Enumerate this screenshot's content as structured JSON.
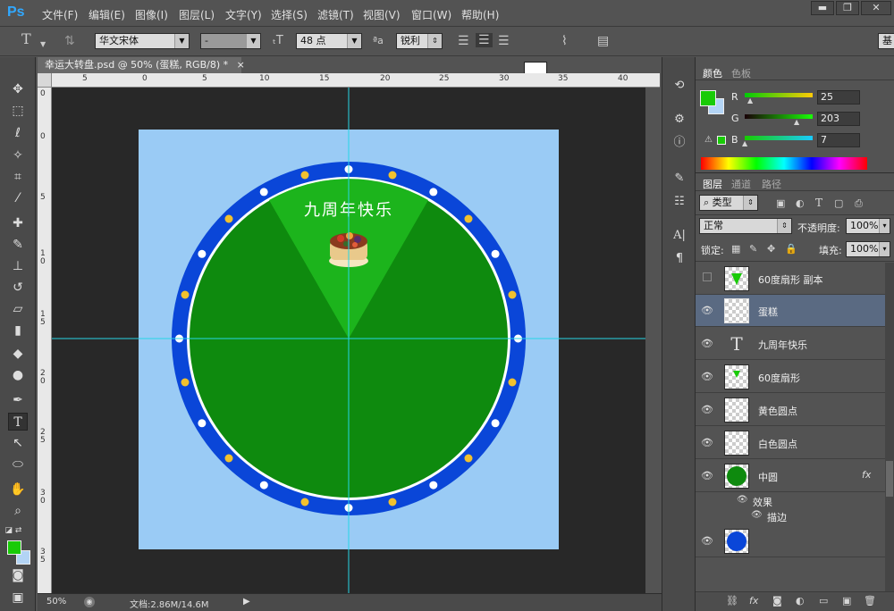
{
  "app": {
    "logo": "Ps"
  },
  "menu": [
    "文件(F)",
    "编辑(E)",
    "图像(I)",
    "图层(L)",
    "文字(Y)",
    "选择(S)",
    "滤镜(T)",
    "视图(V)",
    "窗口(W)",
    "帮助(H)"
  ],
  "window_controls": {
    "minimize": "▬",
    "restore": "❐",
    "close": "✕"
  },
  "options": {
    "tool_glyph": "T",
    "font_family": "华文宋体",
    "font_style": "-",
    "font_size": "48 点",
    "aa_label": "ªa",
    "antialias": "锐利",
    "text_color": "#ffffff",
    "workspace": "基"
  },
  "document": {
    "tab_title": "幸运大转盘.psd @ 50% (蛋糕, RGB/8) *",
    "close": "×",
    "canvas_text": "九周年快乐",
    "ruler_top": [
      "5",
      "0",
      "5",
      "10",
      "15",
      "20",
      "25",
      "30",
      "35",
      "40"
    ],
    "ruler_left": [
      "0",
      "5",
      "1 0",
      "1 5",
      "2 0",
      "2 5",
      "3 0",
      "3 5"
    ],
    "colors": {
      "background": "#9acbf5",
      "ring": "#0a46d8",
      "wheel": "#0e8a0e",
      "sector": "#1cb41c",
      "dot_white": "#ffffff",
      "dot_yellow": "#f2c12e",
      "guide": "#27d6e6"
    }
  },
  "status": {
    "zoom": "50%",
    "doc_info": "文档:2.86M/14.6M",
    "arrow": "▶"
  },
  "color_panel": {
    "tabs": [
      "颜色",
      "色板"
    ],
    "foreground": "#19cb07",
    "background": "#b3d4f5",
    "sliders": [
      {
        "label": "R",
        "value": "25"
      },
      {
        "label": "G",
        "value": "203"
      },
      {
        "label": "B",
        "value": "7"
      }
    ]
  },
  "layers_panel": {
    "tabs": [
      "图层",
      "通道",
      "路径"
    ],
    "filter": "类型",
    "blend_mode": "正常",
    "opacity_label": "不透明度:",
    "opacity": "100%",
    "lock_label": "锁定:",
    "fill_label": "填充:",
    "fill": "100%",
    "layers": [
      {
        "name": "60度扇形 副本",
        "visible": false,
        "selected": false,
        "thumb": "sector"
      },
      {
        "name": "蛋糕",
        "visible": true,
        "selected": true,
        "thumb": "empty"
      },
      {
        "name": "九周年快乐",
        "visible": true,
        "selected": false,
        "thumb": "text"
      },
      {
        "name": "60度扇形",
        "visible": true,
        "selected": false,
        "thumb": "sector-small"
      },
      {
        "name": "黄色圆点",
        "visible": true,
        "selected": false,
        "thumb": "empty"
      },
      {
        "name": "白色圆点",
        "visible": true,
        "selected": false,
        "thumb": "empty"
      },
      {
        "name": "中圆",
        "visible": true,
        "selected": false,
        "thumb": "circle",
        "fx": "fx"
      }
    ],
    "effects_label": "效果",
    "stroke_label": "描边",
    "footer_icons": [
      "⛓",
      "fx",
      "◙",
      "◐",
      "▭",
      "▣",
      "🗑"
    ]
  }
}
